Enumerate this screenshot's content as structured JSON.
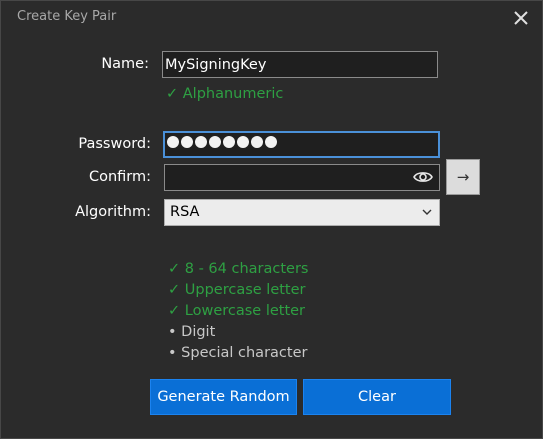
{
  "window": {
    "title": "Create Key Pair",
    "close_glyph": "✕"
  },
  "form": {
    "name": {
      "label": "Name:",
      "value": "MySigningKey"
    },
    "name_validation": "✓ Alphanumeric",
    "password": {
      "label": "Password:",
      "masked_length": 8
    },
    "confirm": {
      "label": "Confirm:",
      "value": ""
    },
    "reveal_icon": "eye-icon",
    "submit_arrow": "→",
    "algorithm": {
      "label": "Algorithm:",
      "selected": "RSA"
    }
  },
  "rules": [
    {
      "text": "✓ 8 - 64 characters",
      "met": true
    },
    {
      "text": "✓ Uppercase letter",
      "met": true
    },
    {
      "text": "✓ Lowercase letter",
      "met": true
    },
    {
      "text": "• Digit",
      "met": false
    },
    {
      "text": "• Special character",
      "met": false
    }
  ],
  "buttons": {
    "generate": "Generate Random",
    "clear": "Clear"
  },
  "colors": {
    "background": "#2b2b2b",
    "accent": "#0a6fd6",
    "focus_border": "#4a90d8",
    "valid": "#2ea043",
    "muted": "#c8c8c8"
  }
}
